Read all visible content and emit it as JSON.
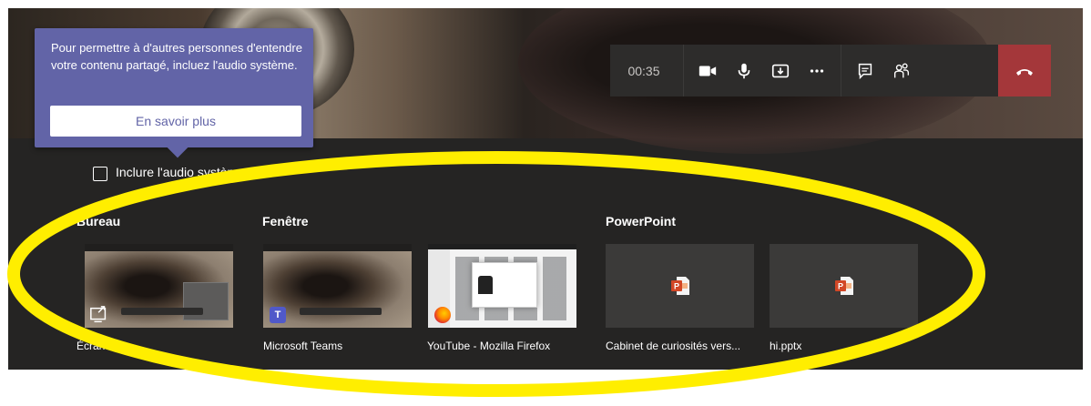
{
  "call": {
    "timer": "00:35",
    "controls": [
      {
        "name": "camera-icon"
      },
      {
        "name": "microphone-icon"
      },
      {
        "name": "share-tray-icon"
      },
      {
        "name": "more-options-icon"
      },
      {
        "name": "chat-icon"
      },
      {
        "name": "participants-icon"
      },
      {
        "name": "hang-up-icon"
      }
    ],
    "accent_colors": {
      "hangup": "#a4373a",
      "teams_purple": "#6264a7",
      "highlight": "#ffee00"
    }
  },
  "tooltip": {
    "text": "Pour permettre à d'autres personnes d'entendre votre contenu partagé, incluez l'audio système.",
    "button": "En savoir plus"
  },
  "share": {
    "include_audio_label": "Inclure l'audio système",
    "include_audio_checked": false,
    "sections": {
      "desktop": "Bureau",
      "window": "Fenêtre",
      "powerpoint": "PowerPoint"
    },
    "tiles": [
      {
        "label": "Écran n° 1",
        "icon": "screen-share-icon"
      },
      {
        "label": "Microsoft Teams",
        "icon": "teams-icon"
      },
      {
        "label": "YouTube - Mozilla Firefox",
        "icon": "firefox-icon"
      },
      {
        "label": "Cabinet de curiosités vers...",
        "icon": "powerpoint-file-icon"
      },
      {
        "label": "hi.pptx",
        "icon": "powerpoint-file-icon"
      }
    ]
  }
}
